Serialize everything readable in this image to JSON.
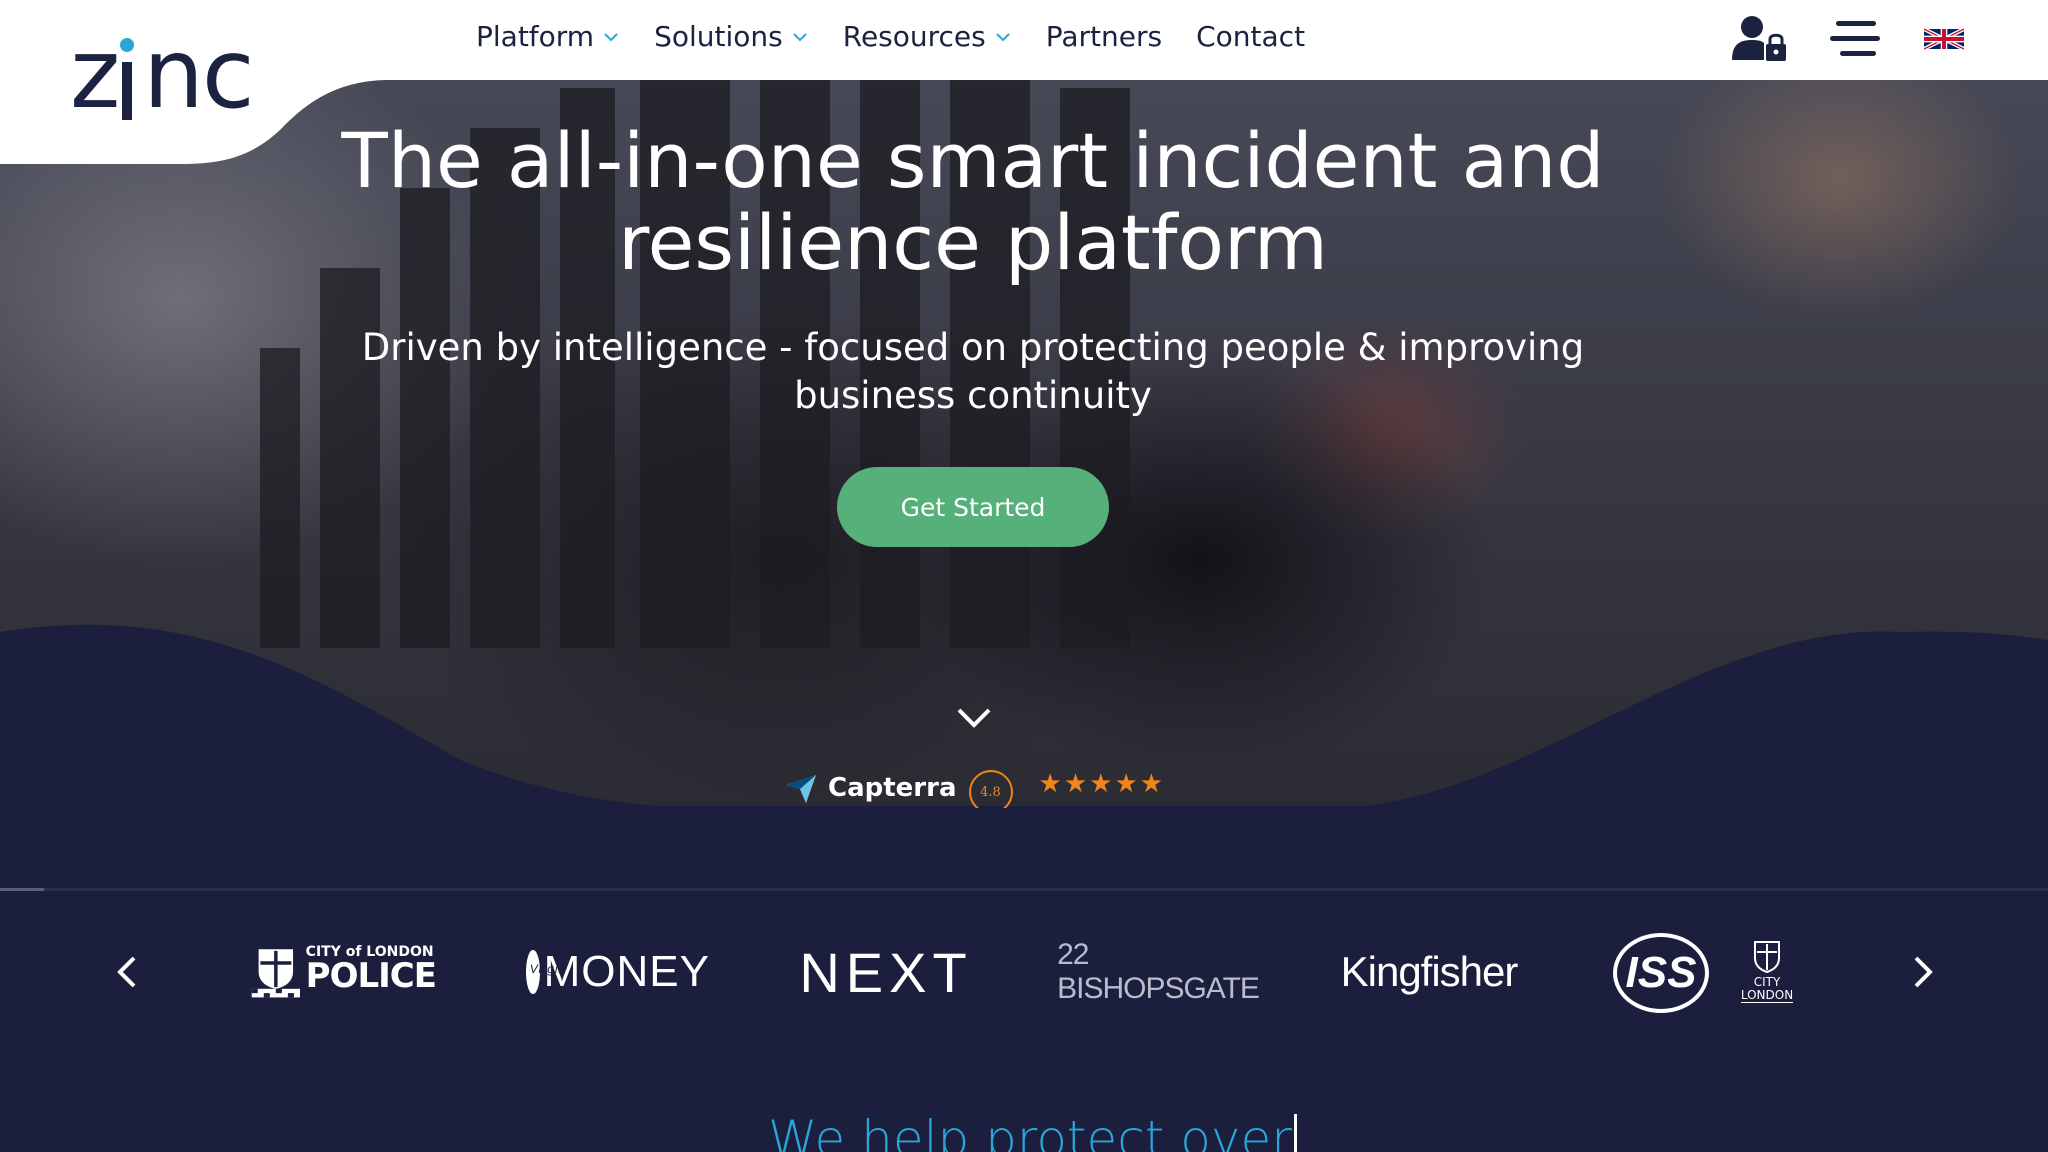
{
  "brand": {
    "logo_text_start": "z",
    "logo_text_i": "i",
    "logo_text_end": "nc"
  },
  "nav": {
    "items": [
      {
        "label": "Platform",
        "dropdown": true
      },
      {
        "label": "Solutions",
        "dropdown": true
      },
      {
        "label": "Resources",
        "dropdown": true
      },
      {
        "label": "Partners",
        "dropdown": false
      },
      {
        "label": "Contact",
        "dropdown": false
      }
    ],
    "icons": [
      "user-lock-icon",
      "hamburger-menu-icon",
      "uk-flag-icon"
    ]
  },
  "hero": {
    "title": "The all-in-one smart incident and resilience platform",
    "subtitle": "Driven by intelligence - focused on protecting people & improving business continuity",
    "cta_label": "Get Started"
  },
  "capterra": {
    "name": "Capterra",
    "rating": "4.8",
    "stars": 5
  },
  "clients": {
    "logos": [
      {
        "id": "city-of-london-police",
        "small": "CITY of LONDON",
        "big": "POLICE"
      },
      {
        "id": "virgin-money",
        "text": "MONEY",
        "badge": "Virgin"
      },
      {
        "id": "next",
        "text": "NEXT"
      },
      {
        "id": "22-bishopsgate",
        "text": "22 BISHOPSGATE"
      },
      {
        "id": "kingfisher",
        "text": "Kingfisher"
      },
      {
        "id": "iss",
        "text": "ISS"
      },
      {
        "id": "city-london",
        "text_top": "CITY",
        "text_bottom": "LONDON"
      }
    ]
  },
  "section": {
    "heading_partial": "We help protect over"
  },
  "colors": {
    "navy": "#1b1f3d",
    "accent_green": "#56b07a",
    "accent_blue": "#2aa6d6",
    "capterra_orange": "#f0851b",
    "logo_navy": "#1b2340"
  }
}
